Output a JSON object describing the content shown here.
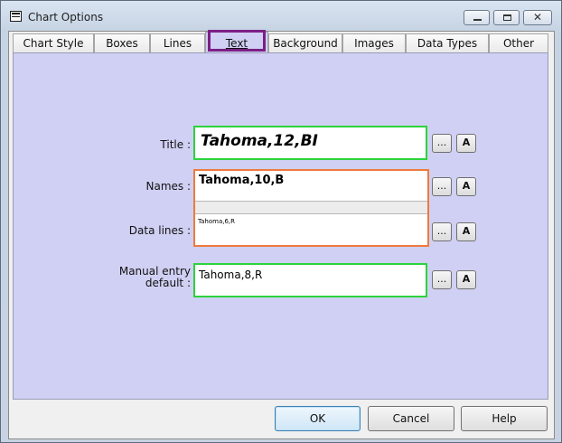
{
  "window": {
    "title": "Chart Options",
    "close_symbol": "✕"
  },
  "tabs": [
    {
      "label": "Chart Style"
    },
    {
      "label": "Boxes"
    },
    {
      "label": "Lines"
    },
    {
      "label": "Text"
    },
    {
      "label": "Background"
    },
    {
      "label": "Images"
    },
    {
      "label": "Data Types"
    },
    {
      "label": "Other"
    }
  ],
  "active_tab": "Text",
  "fields": {
    "title": {
      "label": "Title :",
      "value": "Tahoma,12,BI"
    },
    "names": {
      "label": "Names :",
      "value": "Tahoma,10,B"
    },
    "data_lines": {
      "label": "Data lines :",
      "value": "Tahoma,6,R"
    },
    "manual_entry": {
      "label_line1": "Manual entry",
      "label_line2": "default :",
      "value": "Tahoma,8,R"
    }
  },
  "row_buttons": {
    "browse_label": "...",
    "font_label": "A"
  },
  "footer": {
    "ok_label": "OK",
    "cancel_label": "Cancel",
    "help_label": "Help"
  },
  "colors": {
    "panel_background": "#d0d0f4",
    "valid_border": "#2bd33b",
    "selected_border": "#ee7a3d",
    "tab_highlight": "#7b1f86"
  },
  "icons": [
    "app-icon",
    "minimize-icon",
    "maximize-icon",
    "close-icon"
  ]
}
